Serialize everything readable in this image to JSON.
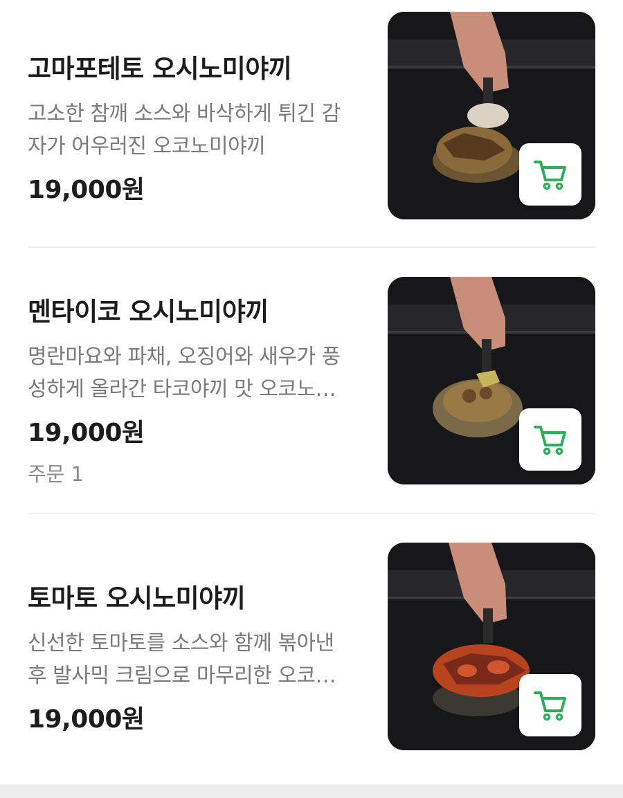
{
  "menu": {
    "items": [
      {
        "title": "고마포테토 오시노미야끼",
        "description": "고소한 참깨 소스와 바삭하게 튀긴 감자가 어우러진 오코노미야끼",
        "price": "19,000원",
        "orders": "",
        "topping_color": "#8a6a3a",
        "accent_color": "#d9d2c2"
      },
      {
        "title": "멘타이코 오시노미야끼",
        "description": "명란마요와 파채, 오징어와 새우가 풍성하게 올라간 타코야끼 맛 오코노미야끼",
        "price": "19,000원",
        "orders": "주문 1",
        "topping_color": "#9a7a44",
        "accent_color": "#c8b45a"
      },
      {
        "title": "토마토 오시노미야끼",
        "description": "신선한 토마토를 소스와 함께 볶아낸 후 발사믹 크림으로 마무리한 오코노미야끼",
        "price": "19,000원",
        "orders": "",
        "topping_color": "#b8431f",
        "accent_color": "#7a2a1a"
      }
    ],
    "cart_icon": "cart-icon",
    "colors": {
      "cart_green": "#2fae5a",
      "divider": "#eeeeee"
    }
  }
}
